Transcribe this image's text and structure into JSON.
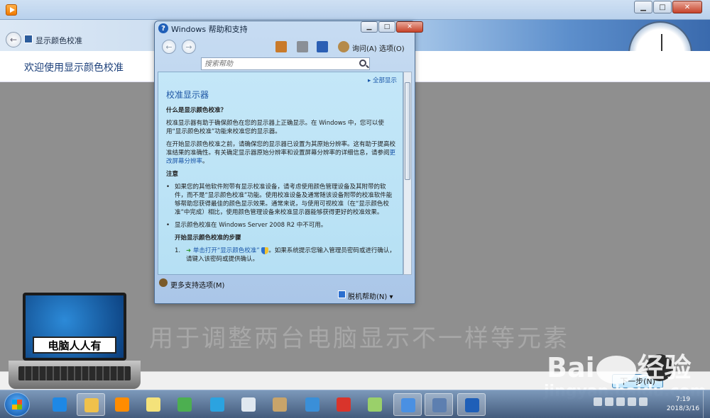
{
  "calibration": {
    "title": "显示颜色校准",
    "welcome": "欢迎使用显示颜色校准",
    "next_label": "下一步(N)"
  },
  "help": {
    "window_title": "Windows 帮助和支持",
    "toolbar": {
      "ask": "询问(A)",
      "options": "选项(O)"
    },
    "search_placeholder": "搜索帮助",
    "all_help": "全部显示",
    "heading": "校准显示器",
    "q1": "什么是显示颜色校准？",
    "p1": "校准显示器有助于确保颜色在您的显示器上正确显示。在 Windows 中，您可以使用“显示颜色校准”功能来校准您的显示器。",
    "p2_a": "在开始显示颜色校准之前，请确保您的显示器已设置为其原始分辨率。这有助于提高校准结果的准确性。有关确定显示器原始分辨率和设置屏幕分辨率的详细信息，请参阅",
    "p2_link": "更改屏幕分辨率",
    "p2_b": "。",
    "note_title": "注意",
    "note1": "如果您的其他软件附带有显示校准设备，请考虑使用颜色管理设备及其附带的软件，而不是“显示颜色校准”功能。使用校准设备及通常随该设备附带的校准软件能够帮助您获得最佳的颜色显示效果。通常来说，与使用可视校准（在“显示颜色校准”中完成）相比，使用颜色管理设备来校准显示器能够获得更好的校准效果。",
    "note2": "显示颜色校准在 Windows Server 2008 R2 中不可用。",
    "steps_title": "开始显示颜色校准的步骤",
    "step1_num": "1.",
    "step1_link": "单击打开“显示颜色校准”",
    "step1_text": "。如果系统提示您输入管理员密码或进行确认，请键入该密码或提供确认。",
    "more_support": "更多支持选项(M)",
    "offline_help": "脱机帮助(N) ▾"
  },
  "overlay": {
    "watermark": "用于调整两台电脑显示不一样等元素",
    "laptop_label": "电脑人人有",
    "baidu_left": "Bai",
    "baidu_right": "经验",
    "baidu_url": "jingyan.baidu.com"
  },
  "taskbar": {
    "time": "7:19",
    "date": "2018/3/16",
    "apps": [
      {
        "name": "ie-icon",
        "color": "#1e88e5"
      },
      {
        "name": "explorer-icon",
        "color": "#f0c14b"
      },
      {
        "name": "media-player-icon",
        "color": "#ff8c00"
      },
      {
        "name": "sticky-notes-icon",
        "color": "#f4e27a"
      },
      {
        "name": "chrome-icon",
        "color": "#4caf50"
      },
      {
        "name": "search-app-icon",
        "color": "#2ba3e0"
      },
      {
        "name": "document-icon",
        "color": "#e0e8f0"
      },
      {
        "name": "paint-icon",
        "color": "#c8a46a"
      },
      {
        "name": "monitor-icon",
        "color": "#3a8fd8"
      },
      {
        "name": "chess-icon",
        "color": "#d9342b"
      },
      {
        "name": "recycle-icon",
        "color": "#9ad06a"
      },
      {
        "name": "network-icon",
        "color": "#4a90e2"
      },
      {
        "name": "display-calibration-icon",
        "color": "#5d7fb0"
      },
      {
        "name": "help-icon",
        "color": "#1f5fb8"
      }
    ]
  }
}
